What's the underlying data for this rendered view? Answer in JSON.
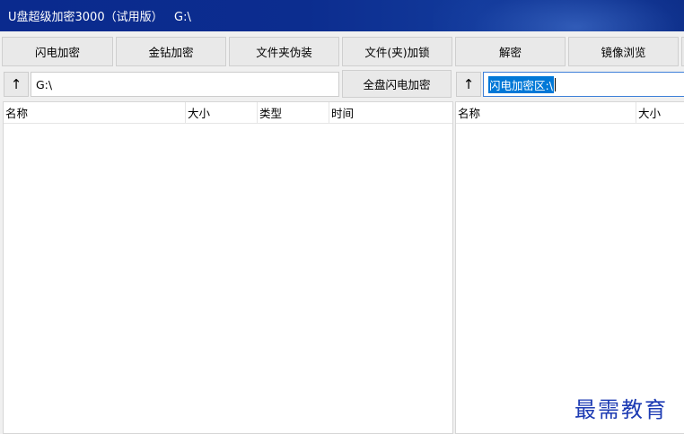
{
  "window": {
    "title": "U盘超级加密3000（试用版）   G:\\"
  },
  "toolbar": {
    "flash_encrypt": "闪电加密",
    "gold_encrypt": "金钻加密",
    "folder_disguise": "文件夹伪装",
    "file_lock": "文件(夹)加锁",
    "decrypt": "解密",
    "mirror_browse": "镜像浏览"
  },
  "left_pane": {
    "up_label": "↑",
    "path_value": "G:\\",
    "whole_disk_button": "全盘闪电加密",
    "columns": [
      "名称",
      "大小",
      "类型",
      "时间"
    ],
    "rows": []
  },
  "right_pane": {
    "up_label": "↑",
    "path_value": "闪电加密区:\\",
    "columns": [
      "名称",
      "大小"
    ],
    "rows": []
  },
  "watermark": "最需教育",
  "colors": {
    "titlebar": "#0c2d8f",
    "selection": "#0078d7",
    "watermark": "#1d3bb3"
  }
}
